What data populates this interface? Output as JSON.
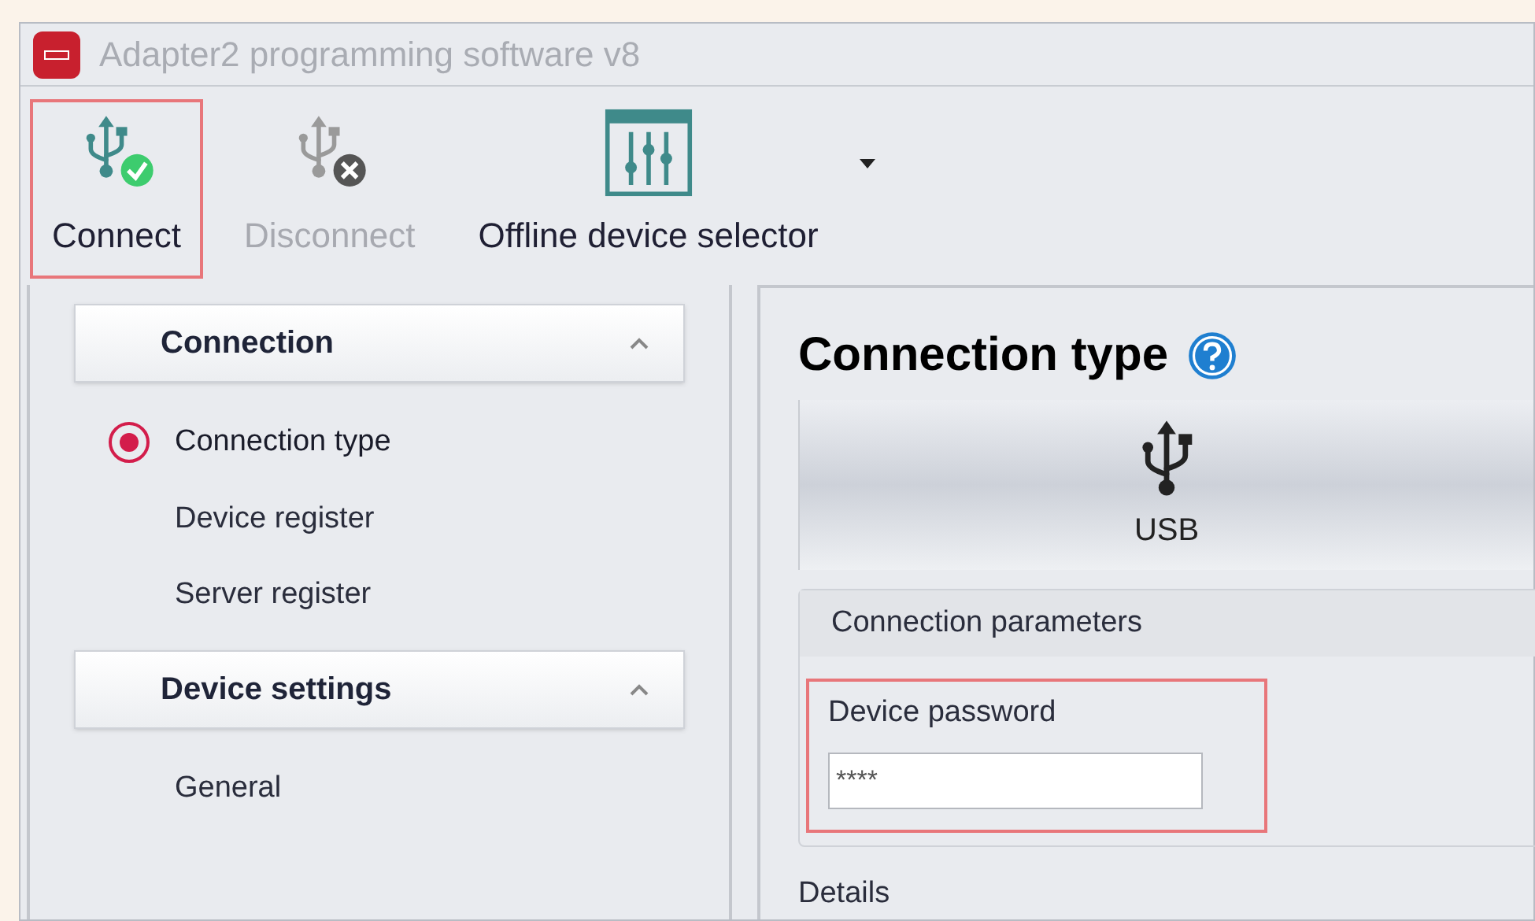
{
  "window": {
    "title": "Adapter2 programming software v8"
  },
  "toolbar": [
    {
      "label": "Connect",
      "kind": "connect",
      "disabled": false,
      "highlighted": true
    },
    {
      "label": "Disconnect",
      "kind": "disconnect",
      "disabled": true,
      "highlighted": false
    },
    {
      "label": "Offline device selector",
      "kind": "selector",
      "disabled": false,
      "highlighted": false
    }
  ],
  "sidebar": {
    "groups": [
      {
        "title": "Connection",
        "expanded": true,
        "items": [
          {
            "label": "Connection type",
            "selected": true
          },
          {
            "label": "Device register",
            "selected": false
          },
          {
            "label": "Server register",
            "selected": false
          }
        ]
      },
      {
        "title": "Device settings",
        "expanded": true,
        "items": [
          {
            "label": "General",
            "selected": false
          }
        ]
      }
    ]
  },
  "content": {
    "title": "Connection type",
    "connection_options": [
      {
        "label": "USB",
        "selected": true
      }
    ],
    "parameters": {
      "title": "Connection parameters",
      "password": {
        "label": "Device password",
        "value": "****",
        "highlighted": true
      }
    },
    "details_label": "Details"
  }
}
